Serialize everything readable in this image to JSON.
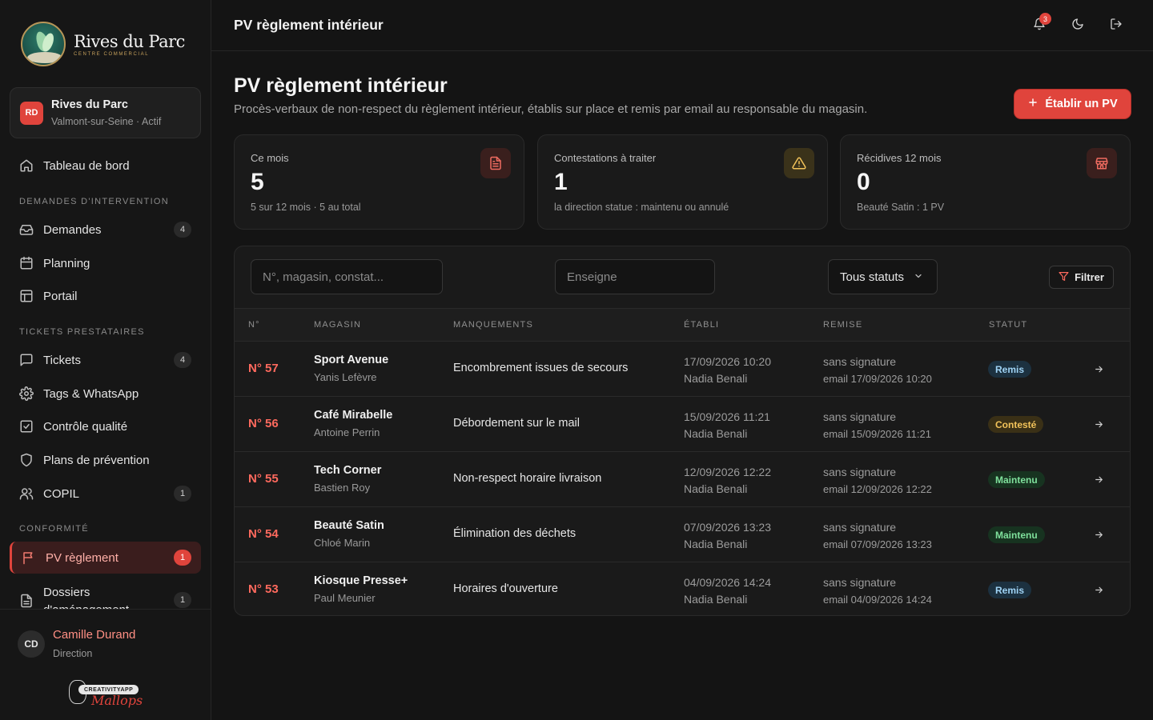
{
  "brand": {
    "name": "Rives du Parc",
    "tagline": "CENTRE COMMERCIAL"
  },
  "site": {
    "initials": "RD",
    "name": "Rives du Parc",
    "location": "Valmont-sur-Seine · Actif"
  },
  "nav": {
    "dashboard": "Tableau de bord",
    "section_interventions": "DEMANDES D'INTERVENTION",
    "demandes": {
      "label": "Demandes",
      "count": "4"
    },
    "planning": "Planning",
    "portail": "Portail",
    "section_tickets": "TICKETS PRESTATAIRES",
    "tickets": {
      "label": "Tickets",
      "count": "4"
    },
    "tags": "Tags & WhatsApp",
    "controle": "Contrôle qualité",
    "plans": "Plans de prévention",
    "copil": {
      "label": "COPIL",
      "count": "1"
    },
    "section_conformite": "CONFORMITÉ",
    "pv": {
      "label": "PV règlement",
      "count": "1"
    },
    "dossiers": {
      "label": "Dossiers d'aménagement",
      "count": "1"
    }
  },
  "user": {
    "initials": "CD",
    "name": "Camille Durand",
    "role": "Direction"
  },
  "footer_brand": {
    "pill": "CREATIVITYAPP",
    "script": "Mallops"
  },
  "topbar": {
    "title": "PV règlement intérieur",
    "notification_count": "3"
  },
  "page": {
    "title": "PV règlement intérieur",
    "description": "Procès-verbaux de non-respect du règlement intérieur, établis sur place et remis par email au responsable du magasin.",
    "primary_action": "Établir un PV"
  },
  "stats": [
    {
      "label": "Ce mois",
      "value": "5",
      "note": "5 sur 12 mois · 5 au total",
      "icon": "document-icon",
      "color": "#e0443c"
    },
    {
      "label": "Contestations à traiter",
      "value": "1",
      "note": "la direction statue : maintenu ou annulé",
      "icon": "warning-icon",
      "color": "#f2c35a"
    },
    {
      "label": "Récidives 12 mois",
      "value": "0",
      "note": "Beauté Satin : 1 PV",
      "icon": "store-icon",
      "color": "#e0443c"
    }
  ],
  "filters": {
    "search_placeholder": "N°, magasin, constat...",
    "brand_placeholder": "Enseigne",
    "status_value": "Tous statuts",
    "filter_label": "Filtrer"
  },
  "table": {
    "columns": [
      "N°",
      "MAGASIN",
      "MANQUEMENTS",
      "ÉTABLI",
      "REMISE",
      "STATUT"
    ],
    "rows": [
      {
        "num": "N° 57",
        "shop": "Sport Avenue",
        "person": "Yanis Lefèvre",
        "issue": "Encombrement issues de secours",
        "date": "17/09/2026 10:20",
        "by": "Nadia Benali",
        "remise1": "sans signature",
        "remise2": "email 17/09/2026 10:20",
        "status": "Remis",
        "status_kind": "remis"
      },
      {
        "num": "N° 56",
        "shop": "Café Mirabelle",
        "person": "Antoine Perrin",
        "issue": "Débordement sur le mail",
        "date": "15/09/2026 11:21",
        "by": "Nadia Benali",
        "remise1": "sans signature",
        "remise2": "email 15/09/2026 11:21",
        "status": "Contesté",
        "status_kind": "conteste"
      },
      {
        "num": "N° 55",
        "shop": "Tech Corner",
        "person": "Bastien Roy",
        "issue": "Non-respect horaire livraison",
        "date": "12/09/2026 12:22",
        "by": "Nadia Benali",
        "remise1": "sans signature",
        "remise2": "email 12/09/2026 12:22",
        "status": "Maintenu",
        "status_kind": "maintenu"
      },
      {
        "num": "N° 54",
        "shop": "Beauté Satin",
        "person": "Chloé Marin",
        "issue": "Élimination des déchets",
        "date": "07/09/2026 13:23",
        "by": "Nadia Benali",
        "remise1": "sans signature",
        "remise2": "email 07/09/2026 13:23",
        "status": "Maintenu",
        "status_kind": "maintenu"
      },
      {
        "num": "N° 53",
        "shop": "Kiosque Presse+",
        "person": "Paul Meunier",
        "issue": "Horaires d'ouverture",
        "date": "04/09/2026 14:24",
        "by": "Nadia Benali",
        "remise1": "sans signature",
        "remise2": "email 04/09/2026 14:24",
        "status": "Remis",
        "status_kind": "remis"
      }
    ]
  }
}
